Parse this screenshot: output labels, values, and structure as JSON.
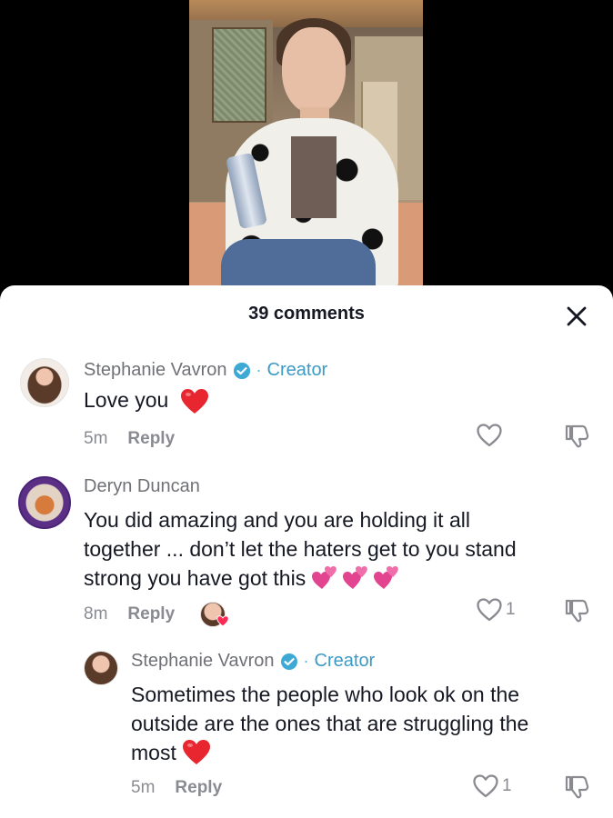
{
  "comments_panel": {
    "count_label": "39 comments"
  },
  "comments": [
    {
      "author": "Stephanie Vavron",
      "badge": "Creator",
      "separator": "·",
      "text": "Love you",
      "time": "5m",
      "reply_label": "Reply",
      "likes": ""
    },
    {
      "author": "Deryn Duncan",
      "text_line1": "You did amazing and you are holding it all",
      "text_line2": "together ... don’t let the haters get to you stand",
      "text_line3": "strong you have got this",
      "time": "8m",
      "reply_label": "Reply",
      "likes": "1"
    }
  ],
  "replies": [
    {
      "author": "Stephanie Vavron",
      "badge": "Creator",
      "separator": "·",
      "text_line1": "Sometimes the people who look ok on the",
      "text_line2": "outside are the ones that are struggling the",
      "text_line3": "most",
      "time": "5m",
      "reply_label": "Reply",
      "likes": "1"
    }
  ],
  "colors": {
    "creator_accent": "#3b9bc6",
    "heart_red": "#e8262f",
    "hearts_pink": "#e2448f",
    "text_primary": "#161823",
    "text_secondary": "#8a8b91"
  },
  "icons": [
    "close-icon",
    "verified-icon",
    "heart-outline-icon",
    "dislike-icon",
    "red-heart-emoji",
    "pink-hearts-emoji"
  ]
}
